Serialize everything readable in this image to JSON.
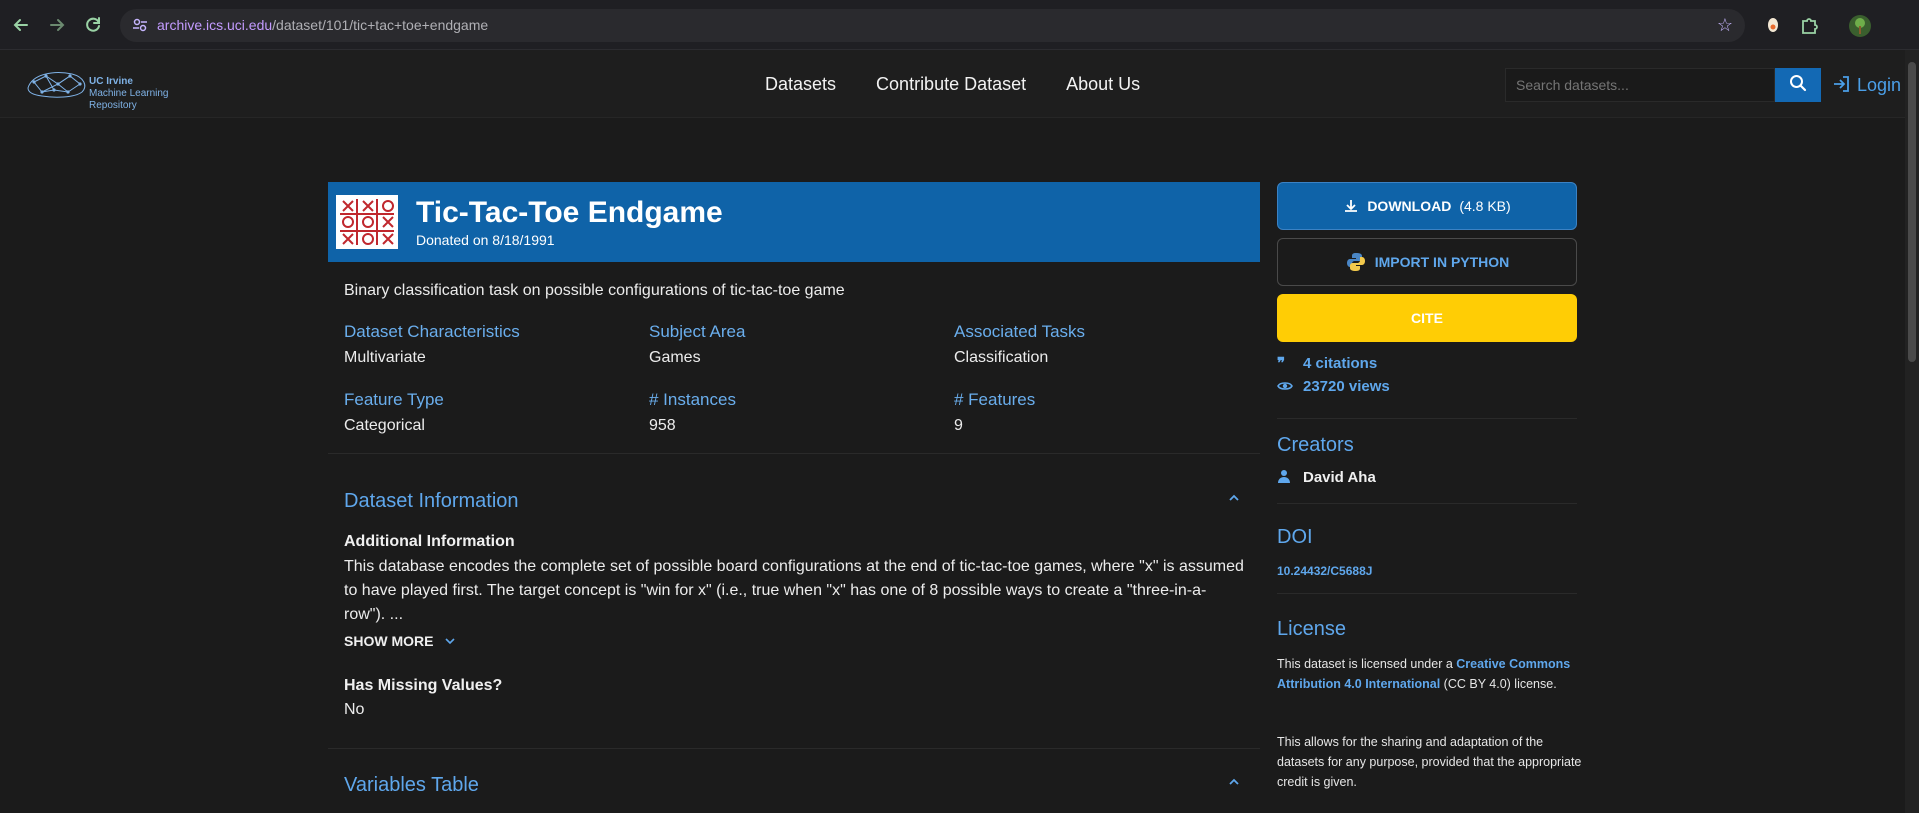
{
  "browser": {
    "url_host": "archive.ics.uci.edu",
    "url_path": "/dataset/101/tic+tac+toe+endgame",
    "icons": [
      "back-icon",
      "forward-icon",
      "reload-icon",
      "site-settings-icon",
      "bookmark-star-icon",
      "extension-icon",
      "puzzle-icon",
      "profile-icon"
    ]
  },
  "header": {
    "logo_line1": "UC Irvine",
    "logo_line2": "Machine Learning",
    "logo_line3": "Repository",
    "nav": [
      "Datasets",
      "Contribute Dataset",
      "About Us"
    ],
    "search_placeholder": "Search datasets...",
    "login_label": "Login"
  },
  "dataset": {
    "title": "Tic-Tac-Toe Endgame",
    "donated": "Donated on 8/18/1991",
    "summary": "Binary classification task on possible configurations of tic-tac-toe game",
    "props": [
      {
        "key": "Dataset Characteristics",
        "value": "Multivariate"
      },
      {
        "key": "Subject Area",
        "value": "Games"
      },
      {
        "key": "Associated Tasks",
        "value": "Classification"
      },
      {
        "key": "Feature Type",
        "value": "Categorical"
      },
      {
        "key": "# Instances",
        "value": "958"
      },
      {
        "key": "# Features",
        "value": "9"
      }
    ],
    "info_section_title": "Dataset Information",
    "additional_info_heading": "Additional Information",
    "additional_info_text": "This database encodes the complete set of possible board configurations at the end of tic-tac-toe games, where \"x\" is assumed to have played first.  The target concept is \"win for x\" (i.e., true when \"x\" has one of 8 possible ways to create a \"three-in-a-row\").  ...",
    "show_more": "SHOW MORE",
    "missing_heading": "Has Missing Values?",
    "missing_value": "No",
    "variables_section_title": "Variables Table"
  },
  "sidebar": {
    "download_label": "DOWNLOAD",
    "download_size": "(4.8 KB)",
    "import_label": "IMPORT IN PYTHON",
    "cite_label": "CITE",
    "citations": "4 citations",
    "views": "23720 views",
    "creators_heading": "Creators",
    "creator_name": "David Aha",
    "doi_heading": "DOI",
    "doi_value": "10.24432/C5688J",
    "license_heading": "License",
    "license_pre": "This dataset is licensed under a ",
    "license_link": "Creative Commons Attribution 4.0 International",
    "license_post": " (CC BY 4.0) license.",
    "license_p2": "This allows for the sharing and adaptation of the datasets for any purpose, provided that the appropriate credit is given."
  },
  "colors": {
    "accent_blue": "#0f63a8",
    "link_blue": "#5fa7ec",
    "cite_yellow": "#ffcd05",
    "background": "#1b1b1b"
  }
}
